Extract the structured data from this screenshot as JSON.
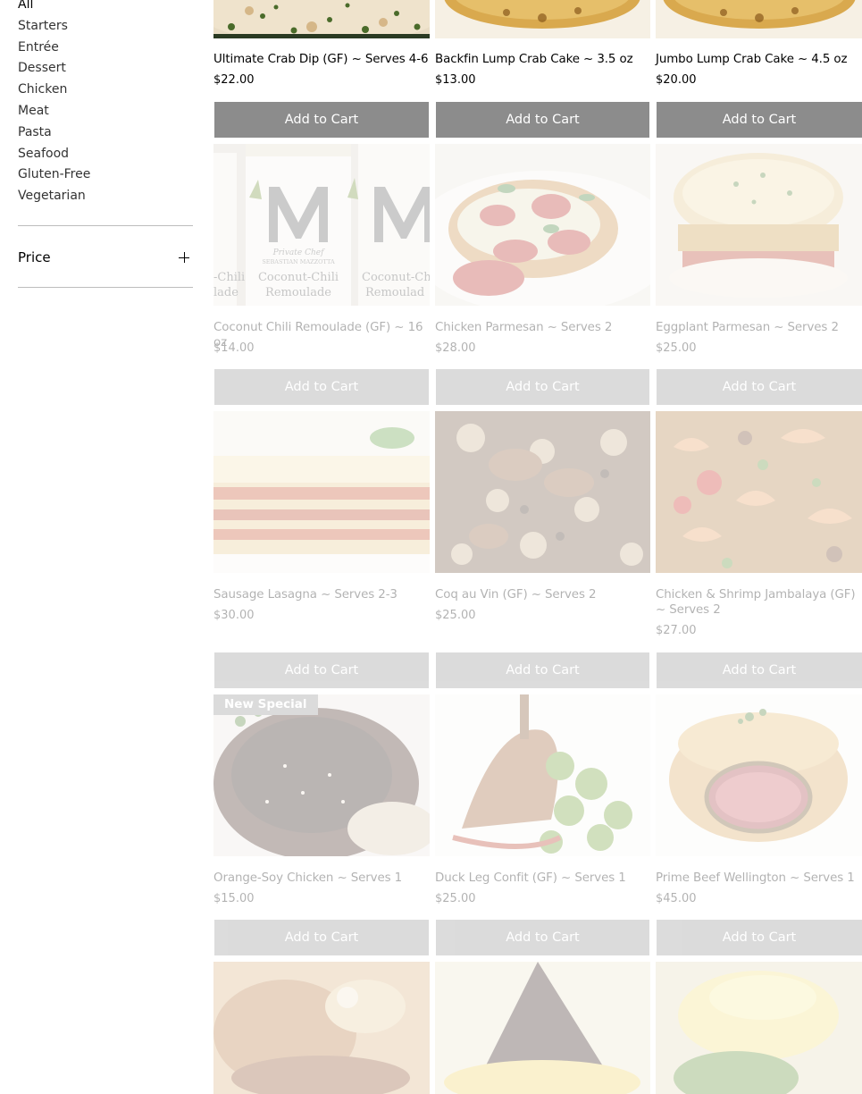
{
  "sidebar": {
    "categories": [
      "All",
      "Starters",
      "Entrée",
      "Dessert",
      "Chicken",
      "Meat",
      "Pasta",
      "Seafood",
      "Gluten-Free",
      "Vegetarian"
    ],
    "price_filter_label": "Price"
  },
  "colors": {
    "button_bg": "#8c8c8c",
    "button_text": "#ffffff",
    "divider": "#bdbdbd",
    "page_bg": "#ffffff"
  },
  "products": [
    {
      "name": "Ultimate Crab Dip (GF) ~ Serves 4-6",
      "price": "$22.00",
      "button": "Add to Cart"
    },
    {
      "name": "Backfin Lump Crab Cake ~ 3.5 oz",
      "price": "$13.00",
      "button": "Add to Cart"
    },
    {
      "name": "Jumbo Lump Crab Cake ~ 4.5 oz",
      "price": "$20.00",
      "button": "Add to Cart"
    },
    {
      "name": "Coconut Chili Remoulade (GF) ~ 16 oz",
      "price": "$14.00",
      "button": "Add to Cart",
      "image_text": {
        "brand": "M",
        "line1": "Private Chef",
        "line2": "SEBASTIAN MAZZOTTA",
        "product1": "Coconut-Chili",
        "product2": "Remoulade"
      }
    },
    {
      "name": "Chicken Parmesan ~ Serves 2",
      "price": "$28.00",
      "button": "Add to Cart"
    },
    {
      "name": "Eggplant Parmesan ~ Serves 2",
      "price": "$25.00",
      "button": "Add to Cart"
    },
    {
      "name": "Sausage Lasagna ~ Serves 2-3",
      "price": "$30.00",
      "button": "Add to Cart"
    },
    {
      "name": "Coq au Vin (GF) ~ Serves 2",
      "price": "$25.00",
      "button": "Add to Cart"
    },
    {
      "name": "Chicken & Shrimp Jambalaya (GF) ~ Serves 2",
      "price": "$27.00",
      "button": "Add to Cart"
    },
    {
      "name": "Orange-Soy Chicken ~ Serves 1",
      "price": "$15.00",
      "button": "Add to Cart",
      "ribbon": "New Special"
    },
    {
      "name": "Duck Leg Confit (GF) ~ Serves 1",
      "price": "$25.00",
      "button": "Add to Cart"
    },
    {
      "name": "Prime Beef Wellington ~ Serves 1",
      "price": "$45.00",
      "button": "Add to Cart"
    }
  ]
}
